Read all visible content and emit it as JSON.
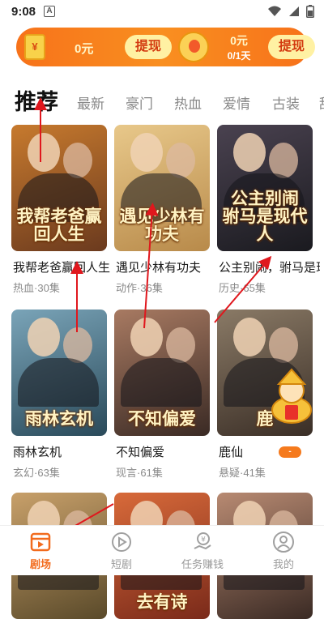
{
  "status_bar": {
    "time": "9:08",
    "notification_glyph": "A"
  },
  "reward_bar": {
    "envelope_symbol": "¥",
    "balance": "0元",
    "withdraw_label": "提现",
    "daily_reward": "0元",
    "daily_progress": "0/1天",
    "withdraw2_label": "提现"
  },
  "tabs": [
    {
      "label": "推荐",
      "active": true
    },
    {
      "label": "最新"
    },
    {
      "label": "豪门"
    },
    {
      "label": "热血"
    },
    {
      "label": "爱情"
    },
    {
      "label": "古装"
    },
    {
      "label": "甜"
    }
  ],
  "dramas": [
    {
      "title": "我帮老爸赢回人生",
      "genre": "热血",
      "episodes": "30集",
      "poster_text": "我帮老爸赢回人生",
      "palette": [
        "#6b3a1e",
        "#c77a2e"
      ]
    },
    {
      "title": "遇见少林有功夫",
      "genre": "动作",
      "episodes": "36集",
      "poster_text": "遇见少林有功夫",
      "palette": [
        "#b88a4a",
        "#e8c88a"
      ]
    },
    {
      "title": "公主别闹，驸马是现代人",
      "genre": "历史",
      "episodes": "65集",
      "poster_text": "公主别闹 驸马是现代人",
      "palette": [
        "#1a1a1f",
        "#4a4250"
      ]
    },
    {
      "title": "雨林玄机",
      "genre": "玄幻",
      "episodes": "63集",
      "poster_text": "雨林玄机",
      "palette": [
        "#2a4a5a",
        "#7aa4b8"
      ]
    },
    {
      "title": "不知偏爱",
      "genre": "现言",
      "episodes": "61集",
      "poster_text": "不知偏爱",
      "palette": [
        "#3a2a24",
        "#a87a62"
      ]
    },
    {
      "title": "鹿仙",
      "genre": "悬疑",
      "episodes": "41集",
      "poster_text": "鹿",
      "palette": [
        "#3a2e26",
        "#8a7a66"
      ]
    },
    {
      "title": "",
      "genre": "",
      "episodes": "",
      "poster_text": "",
      "palette": [
        "#5a4a2a",
        "#c8a06a"
      ]
    },
    {
      "title": "",
      "genre": "",
      "episodes": "",
      "poster_text": "去有诗",
      "palette": [
        "#7a2a1a",
        "#d86a3a"
      ]
    },
    {
      "title": "",
      "genre": "",
      "episodes": "",
      "poster_text": "",
      "palette": [
        "#3a2a24",
        "#b88a72"
      ]
    }
  ],
  "floating_badge": {
    "label": "-"
  },
  "bottom_nav": [
    {
      "label": "剧场",
      "icon": "theater-icon",
      "active": true
    },
    {
      "label": "短剧",
      "icon": "play-circle-icon"
    },
    {
      "label": "任务赚钱",
      "icon": "money-hand-icon"
    },
    {
      "label": "我的",
      "icon": "user-icon"
    }
  ],
  "colors": {
    "accent": "#f26b1d",
    "reward_bar": "#f98f20",
    "annotation": "#e0171d"
  }
}
